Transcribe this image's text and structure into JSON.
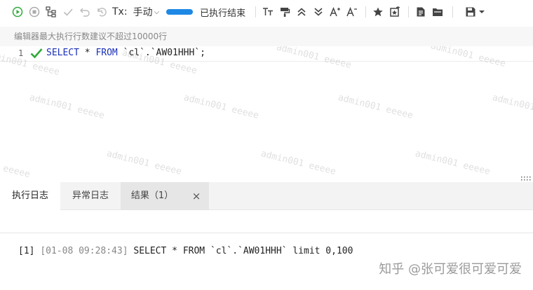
{
  "toolbar": {
    "tx_label": "Tx:",
    "tx_mode": "手动",
    "progress_percent": 100,
    "status": "已执行结束",
    "icons": [
      "run-icon",
      "stop-icon",
      "explain-icon",
      "commit-icon",
      "rollback-icon",
      "history-icon",
      "text-case-icon",
      "format-icon",
      "collapse-icon",
      "expand-icon",
      "font-increase-icon",
      "font-decrease-icon",
      "star-icon",
      "add-favorite-icon",
      "sql-file-icon",
      "folder-icon",
      "save-icon",
      "dropdown-icon"
    ]
  },
  "hint": "编辑器最大执行行数建议不超过10000行",
  "editor": {
    "line_number": "1",
    "kw_select": "SELECT",
    "star": " * ",
    "kw_from": "FROM",
    "table": " `cl`.`AW01HHH`;"
  },
  "watermark": "admin001 eeeee",
  "tabs": [
    "执行日志",
    "异常日志",
    "结果（1）"
  ],
  "close_label": "×",
  "log": {
    "index": "[1]",
    "time": "[01-08 09:28:43]",
    "sql": "SELECT * FROM `cl`.`AW01HHH` limit 0,100"
  },
  "credit": "知乎 @张可爱很可爱可爱",
  "colors": {
    "accent": "#1e88e5",
    "success": "#2eaa3a",
    "keyword": "#1a2fb8"
  }
}
